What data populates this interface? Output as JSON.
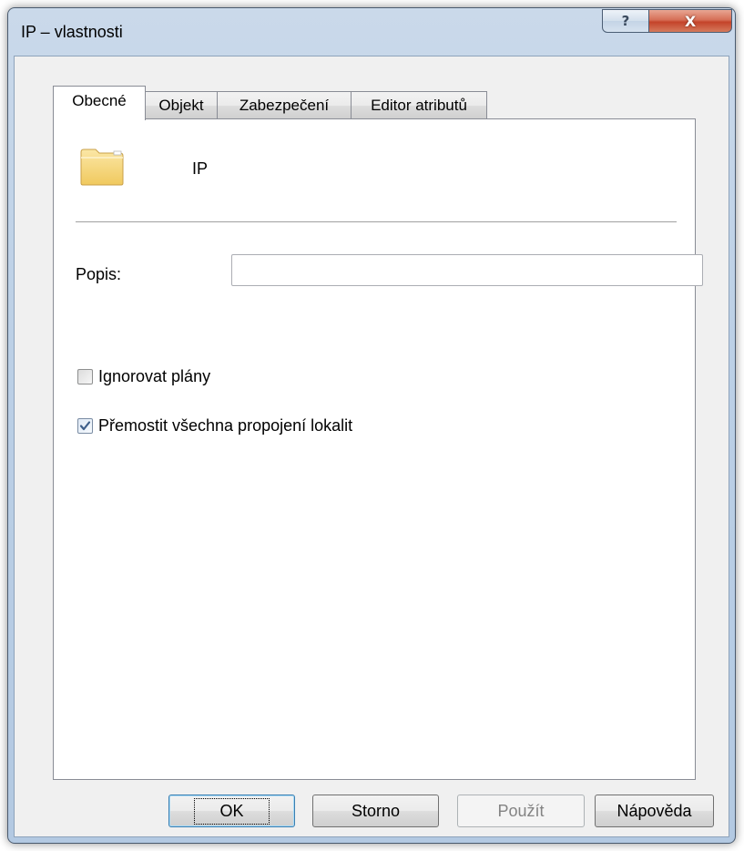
{
  "window": {
    "title": "IP – vlastnosti",
    "help_glyph": "?",
    "close_glyph": "X"
  },
  "tabs": [
    {
      "label": "Obecné",
      "active": true
    },
    {
      "label": "Objekt",
      "active": false
    },
    {
      "label": "Zabezpečení",
      "active": false
    },
    {
      "label": "Editor atributů",
      "active": false
    }
  ],
  "general": {
    "icon": "folder-icon",
    "object_name": "IP",
    "description_label": "Popis:",
    "description_value": "",
    "ignore_schedules": {
      "label": "Ignorovat plány",
      "checked": false
    },
    "bridge_all_links": {
      "label": "Přemostit všechna propojení lokalit",
      "checked": true
    }
  },
  "buttons": {
    "ok": "OK",
    "cancel": "Storno",
    "apply": "Použít",
    "help": "Nápověda"
  },
  "colors": {
    "title_gradient_top": "#cad9ea",
    "close_button": "#c4432a",
    "dialog_face": "#f0f0f0",
    "check_mark": "#3e5f8a"
  }
}
